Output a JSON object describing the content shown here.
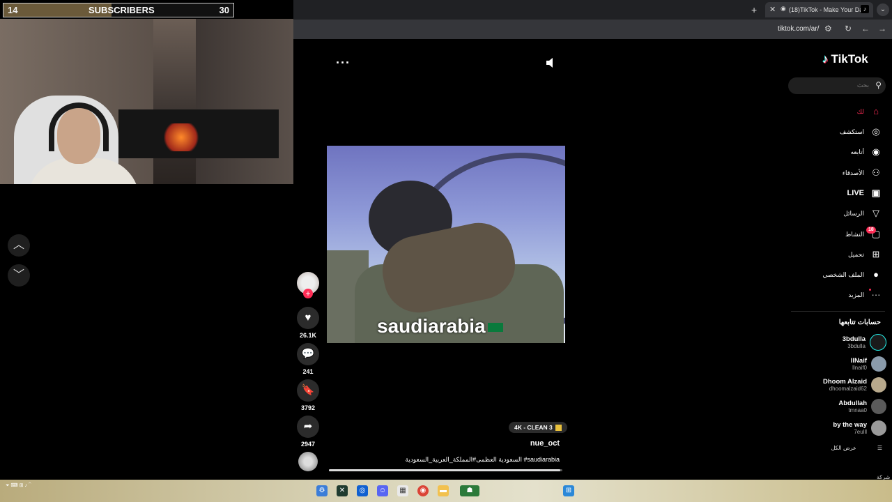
{
  "subscriber_bar": {
    "left_count": "14",
    "title": "SUBSCRIBERS",
    "right_count": "30",
    "progress_fraction": 0.47
  },
  "browser": {
    "tab_title": "(18)TikTok - Make Your Day",
    "tab_close": "✕",
    "new_tab": "+",
    "menu": "⌄",
    "url": "tiktok.com/ar/"
  },
  "video": {
    "caption_overlay": "saudiarabia",
    "badge": "4K - CLEAN 3",
    "username": "nue_oct",
    "description": "السعودية العظمى#المملكة_العربية_السعودية #saudiarabia",
    "progress_fraction": 0.99
  },
  "actions": {
    "likes": "26.1K",
    "comments": "241",
    "saves": "3792",
    "shares": "2947"
  },
  "sidebar": {
    "logo": "TikTok",
    "search_placeholder": "بحث",
    "nav": [
      {
        "label": "لك",
        "icon": "home-icon"
      },
      {
        "label": "استكشف",
        "icon": "compass-icon"
      },
      {
        "label": "أتابعه",
        "icon": "following-icon"
      },
      {
        "label": "الأصدقاء",
        "icon": "friends-icon"
      },
      {
        "label": "LIVE",
        "icon": "live-icon"
      },
      {
        "label": "الرسائل",
        "icon": "messages-icon"
      },
      {
        "label": "النشاط",
        "icon": "inbox-icon"
      },
      {
        "label": "تحميل",
        "icon": "upload-icon"
      },
      {
        "label": "الملف الشخصي",
        "icon": "profile-icon"
      },
      {
        "label": "المزيد",
        "icon": "more-icon"
      }
    ],
    "inbox_badge": "18",
    "following_title": "حسابات تتابعها",
    "following": [
      {
        "name": "3bdulla",
        "handle": "3bdulla"
      },
      {
        "name": "llNaif",
        "handle": "llnaif0"
      },
      {
        "name": "Dhoom Alzaid",
        "handle": "dhoomalzaid62"
      },
      {
        "name": "Abdullah",
        "handle": "tmnaa0"
      },
      {
        "name": "by the way",
        "handle": "7eulll"
      }
    ],
    "see_all": "عرض الكل",
    "cutoff_text": "شركة"
  },
  "colors": {
    "accent": "#fe2c55",
    "cyan": "#25f4ee",
    "background": "#000000"
  }
}
